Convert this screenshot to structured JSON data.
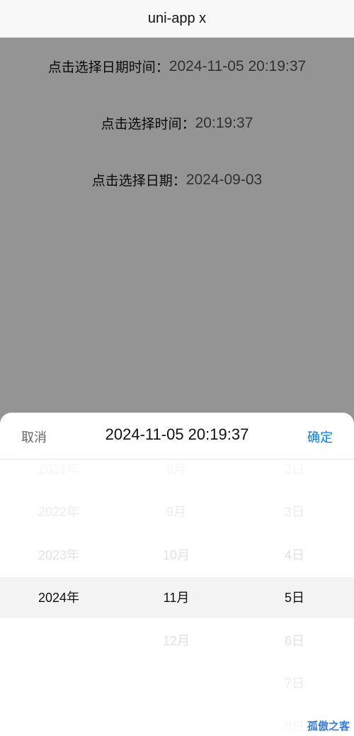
{
  "nav": {
    "title": "uni-app x"
  },
  "rows": [
    {
      "label": "点击选择日期时间：",
      "value": "2024-11-05 20:19:37"
    },
    {
      "label": "点击选择时间：",
      "value": "20:19:37"
    },
    {
      "label": "点击选择日期：",
      "value": "2024-09-03"
    }
  ],
  "picker": {
    "cancel_label": "取消",
    "title": "2024-11-05 20:19:37",
    "confirm_label": "确定",
    "years": [
      "2021年",
      "2022年",
      "2023年",
      "2024年"
    ],
    "months": [
      "8月",
      "9月",
      "10月",
      "11月",
      "12月"
    ],
    "days": [
      "2日",
      "3日",
      "4日",
      "5日",
      "6日",
      "7日",
      "8日"
    ],
    "selected": {
      "year": "2024年",
      "month": "11月",
      "day": "5日"
    }
  },
  "watermark": "孤傲之客",
  "colors": {
    "confirm": "#007aff",
    "mask": "rgba(0,0,0,0.42)",
    "watermark": "#3d7bd6"
  }
}
